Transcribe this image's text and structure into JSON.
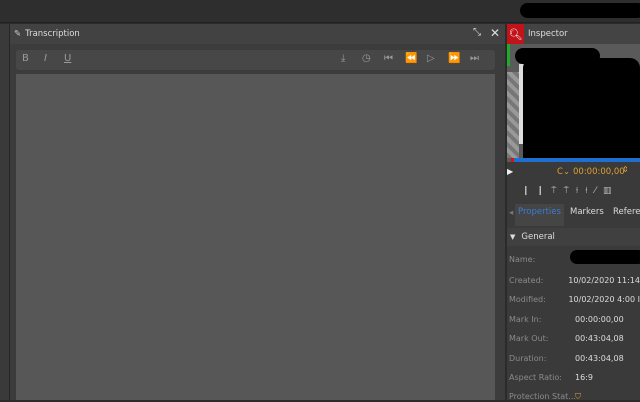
{
  "transcription": {
    "title": "Transcription",
    "toolbar": {
      "bold": "B",
      "italic": "I",
      "underline": "U"
    }
  },
  "inspector": {
    "title": "Inspector",
    "timecode_prefix": "C",
    "timecode": "00:00:00,00",
    "tabs": [
      {
        "label": "Properties",
        "active": true
      },
      {
        "label": "Markers"
      },
      {
        "label": "Referen"
      }
    ],
    "section": "General",
    "properties": [
      {
        "key": "Name:",
        "value": ""
      },
      {
        "key": "Created:",
        "value": "10/02/2020 11:14"
      },
      {
        "key": "Modified:",
        "value": "10/02/2020 4:00 I"
      },
      {
        "key": "Mark In:",
        "value": "00:00:00,00"
      },
      {
        "key": "Mark Out:",
        "value": "00:43:04,08"
      },
      {
        "key": "Duration:",
        "value": "00:43:04,08"
      },
      {
        "key": "Aspect Ratio:",
        "value": "16:9"
      },
      {
        "key": "Protection Stat...",
        "value": ""
      }
    ]
  },
  "colors": {
    "accent_red": "#c1141a",
    "tab_active": "#3d7bd1",
    "timecode": "#e0a030",
    "progress": "#1f6fd0"
  }
}
